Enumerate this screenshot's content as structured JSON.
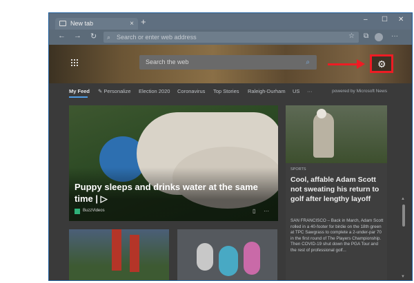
{
  "browser": {
    "tab_title": "New tab",
    "new_tab_symbol": "+",
    "close_tab_symbol": "×",
    "window_controls": {
      "minimize": "–",
      "maximize": "☐",
      "close": "✕"
    },
    "nav": {
      "back": "←",
      "forward": "→",
      "refresh": "↻"
    },
    "address_placeholder": "Search or enter web address",
    "icons": [
      "favorite-icon",
      "collections-icon",
      "profile-icon",
      "more-icon"
    ]
  },
  "newtab": {
    "search_placeholder": "Search the web",
    "settings_icon": "gear-icon",
    "highlight_color": "#ee1c24"
  },
  "feed": {
    "tabs": [
      {
        "label": "My Feed",
        "active": true
      },
      {
        "label": "Personalize"
      },
      {
        "label": "Election 2020"
      },
      {
        "label": "Coronavirus"
      },
      {
        "label": "Top Stories"
      },
      {
        "label": "Raleigh-Durham"
      },
      {
        "label": "US"
      },
      {
        "label": "···"
      }
    ],
    "powered_by": "powered by Microsoft News",
    "main_card": {
      "title": "Puppy sleeps and drinks water at the same time | ▷",
      "source": "BuzzVideos"
    },
    "side_card": {
      "category": "SPORTS",
      "title": "Cool, affable Adam Scott not sweating his return to golf after lengthy layoff",
      "body": "SAN FRANCISCO – Back in March, Adam Scott rolled in a 40-footer for birdie on the 18th green at TPC Sawgrass to complete a 2-under-par 70 in the first round of The Players Championship. Then COVID-19 shut down the PGA Tour and the rest of professional golf..."
    }
  }
}
